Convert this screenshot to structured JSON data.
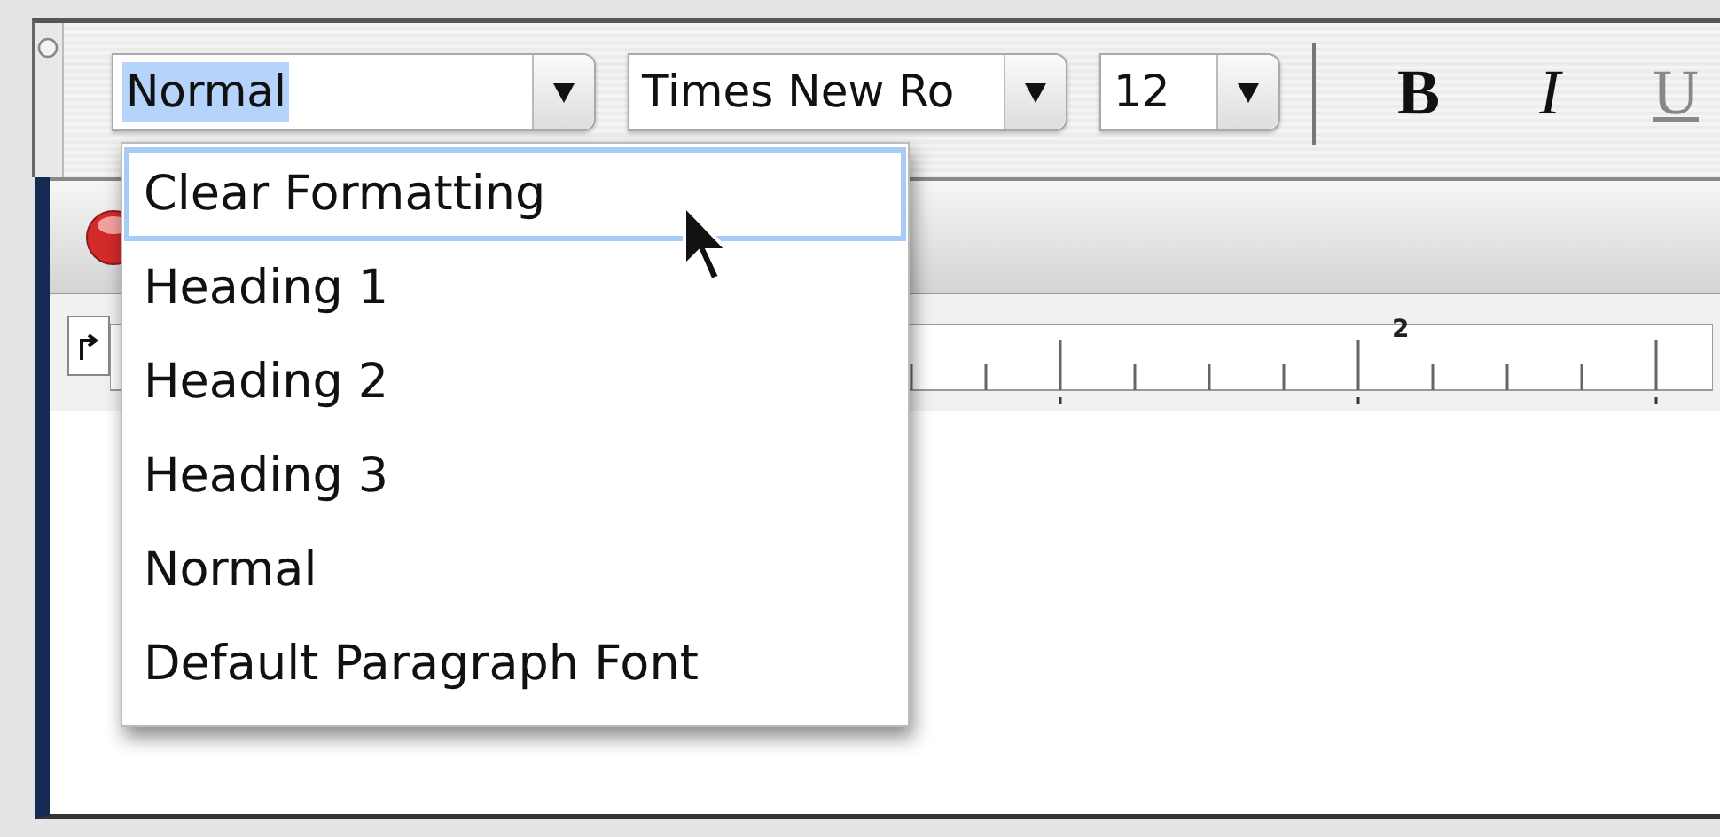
{
  "style_box": {
    "value": "Normal",
    "text_selected": true
  },
  "font_box": {
    "value": "Times New Ro"
  },
  "size_box": {
    "value": "12"
  },
  "format_buttons": [
    {
      "label": "B",
      "kind": "bold"
    },
    {
      "label": "I",
      "kind": "italic"
    },
    {
      "label": "U",
      "kind": "underline"
    }
  ],
  "ruler": {
    "labels": [
      "2"
    ]
  },
  "style_menu": {
    "items": [
      {
        "label": "Clear Formatting",
        "selected": true
      },
      {
        "label": "Heading 1",
        "selected": false
      },
      {
        "label": "Heading 2",
        "selected": false
      },
      {
        "label": "Heading 3",
        "selected": false
      },
      {
        "label": "Normal",
        "selected": false
      },
      {
        "label": "Default Paragraph Font",
        "selected": false
      }
    ]
  }
}
